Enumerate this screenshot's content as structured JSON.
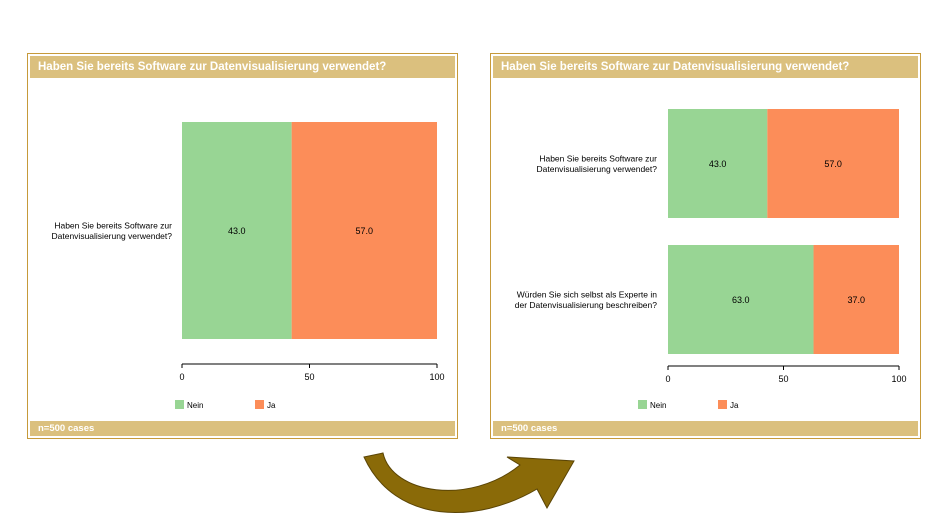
{
  "colors": {
    "nein": "#98d594",
    "ja": "#fc8d59",
    "header": "#dbc07e",
    "border": "#c69a3a",
    "arrow": "#8a6a08"
  },
  "chart_data": [
    {
      "type": "bar",
      "orientation": "horizontal",
      "stacked": true,
      "title": "Haben Sie bereits Software zur Datenvisualisierung verwendet?",
      "footer": "n=500 cases",
      "categories": [
        [
          "Haben Sie bereits Software zur",
          "Datenvisualisierung verwendet?"
        ]
      ],
      "series": [
        {
          "name": "Nein",
          "values": [
            43.0
          ]
        },
        {
          "name": "Ja",
          "values": [
            57.0
          ]
        }
      ],
      "xlim": [
        0,
        100
      ],
      "xticks": [
        0,
        50,
        100
      ],
      "legend": "bottom-left"
    },
    {
      "type": "bar",
      "orientation": "horizontal",
      "stacked": true,
      "title": "Haben Sie bereits Software zur Datenvisualisierung verwendet?",
      "footer": "n=500 cases",
      "categories": [
        [
          "Haben Sie bereits Software zur",
          "Datenvisualisierung verwendet?"
        ],
        [
          "Würden Sie sich selbst als Experte in",
          "der Datenvisualisierung beschreiben?"
        ]
      ],
      "series": [
        {
          "name": "Nein",
          "values": [
            43.0,
            63.0
          ]
        },
        {
          "name": "Ja",
          "values": [
            57.0,
            37.0
          ]
        }
      ],
      "xlim": [
        0,
        100
      ],
      "xticks": [
        0,
        50,
        100
      ],
      "legend": "bottom-left"
    }
  ]
}
